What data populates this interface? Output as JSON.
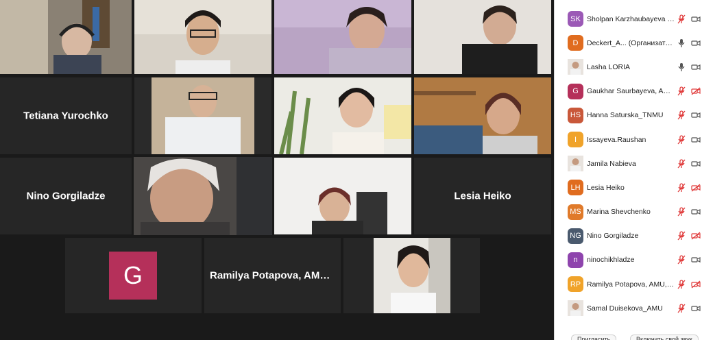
{
  "tiles": {
    "t1": {
      "name": ""
    },
    "t2": {
      "name": ""
    },
    "t3": {
      "name": ""
    },
    "t4": {
      "name": ""
    },
    "tetiana": {
      "name": "Tetiana Yurochko"
    },
    "nino": {
      "name": "Nino Gorgiladze"
    },
    "lesia": {
      "name": "Lesia Heiko"
    },
    "g_avatar_letter": "G",
    "ramilya": {
      "name": "Ramilya Potapova, AMU, N..."
    }
  },
  "participants": [
    {
      "initials": "SK",
      "color": "#9b59b6",
      "name": "Sholpan Karzhaubayeva (я)",
      "mic": "muted",
      "cam": "on"
    },
    {
      "initials": "D",
      "color": "#e06c1f",
      "name": "Deckert_A...  (Организатор)",
      "mic": "on",
      "cam": "on"
    },
    {
      "initials": "",
      "color": "#d9d2cc",
      "name": "Lasha LORIA",
      "mic": "on",
      "cam": "on",
      "photo": true
    },
    {
      "initials": "G",
      "color": "#b5305a",
      "name": "Gaukhar Saurbayeva, AM...",
      "mic": "muted",
      "cam": "off"
    },
    {
      "initials": "HS",
      "color": "#c9583a",
      "name": "Hanna Saturska_TNMU",
      "mic": "muted",
      "cam": "on"
    },
    {
      "initials": "I",
      "color": "#f0a32a",
      "name": "Issayeva.Raushan",
      "mic": "muted",
      "cam": "on"
    },
    {
      "initials": "",
      "color": "#d9d2cc",
      "name": "Jamila Nabieva",
      "mic": "muted",
      "cam": "on",
      "photo": true
    },
    {
      "initials": "LH",
      "color": "#e06c1f",
      "name": "Lesia Heiko",
      "mic": "muted",
      "cam": "off"
    },
    {
      "initials": "MS",
      "color": "#e07a2a",
      "name": "Marina Shevchenko",
      "mic": "muted",
      "cam": "on"
    },
    {
      "initials": "NG",
      "color": "#4a5a6e",
      "name": "Nino Gorgiladze",
      "mic": "muted",
      "cam": "off"
    },
    {
      "initials": "n",
      "color": "#8e44ad",
      "name": "ninochikhladze",
      "mic": "muted",
      "cam": "on"
    },
    {
      "initials": "RP",
      "color": "#f0a32a",
      "name": "Ramilya Potapova, AMU, N...",
      "mic": "muted",
      "cam": "off"
    },
    {
      "initials": "",
      "color": "#d9d2cc",
      "name": "Samal Duisekova_AMU",
      "mic": "muted",
      "cam": "on",
      "photo": true
    }
  ],
  "bottom": {
    "invite": "Пригласить",
    "unmute_self": "Включить свой звук"
  },
  "colors": {
    "muted": "#e03b3b",
    "active_border": "#b8d36b"
  }
}
